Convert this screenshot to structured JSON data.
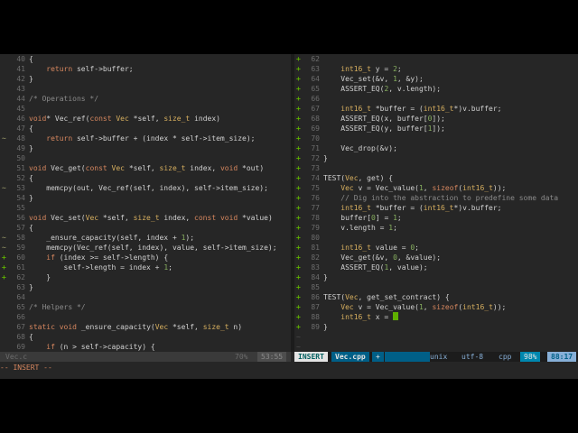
{
  "left_pane": {
    "lines": [
      {
        "n": "40",
        "s": "",
        "t": "{"
      },
      {
        "n": "41",
        "s": "",
        "t": "    return self->buffer;"
      },
      {
        "n": "42",
        "s": "",
        "t": "}"
      },
      {
        "n": "43",
        "s": "",
        "t": ""
      },
      {
        "n": "44",
        "s": "",
        "t": "/* Operations */"
      },
      {
        "n": "45",
        "s": "",
        "t": ""
      },
      {
        "n": "46",
        "s": "",
        "t": "void* Vec_ref(const Vec *self, size_t index)"
      },
      {
        "n": "47",
        "s": "",
        "t": "{"
      },
      {
        "n": "48",
        "s": "~",
        "t": "    return self->buffer + (index * self->item_size);"
      },
      {
        "n": "49",
        "s": "",
        "t": "}"
      },
      {
        "n": "50",
        "s": "",
        "t": ""
      },
      {
        "n": "51",
        "s": "",
        "t": "void Vec_get(const Vec *self, size_t index, void *out)"
      },
      {
        "n": "52",
        "s": "",
        "t": "{"
      },
      {
        "n": "53",
        "s": "~",
        "t": "    memcpy(out, Vec_ref(self, index), self->item_size);"
      },
      {
        "n": "54",
        "s": "",
        "t": "}"
      },
      {
        "n": "55",
        "s": "",
        "t": ""
      },
      {
        "n": "56",
        "s": "",
        "t": "void Vec_set(Vec *self, size_t index, const void *value)"
      },
      {
        "n": "57",
        "s": "",
        "t": "{"
      },
      {
        "n": "58",
        "s": "~",
        "t": "    _ensure_capacity(self, index + 1);"
      },
      {
        "n": "59",
        "s": "~",
        "t": "    memcpy(Vec_ref(self, index), value, self->item_size);"
      },
      {
        "n": "60",
        "s": "+",
        "t": "    if (index >= self->length) {"
      },
      {
        "n": "61",
        "s": "+",
        "t": "        self->length = index + 1;"
      },
      {
        "n": "62",
        "s": "+",
        "t": "    }"
      },
      {
        "n": "63",
        "s": "",
        "t": "}"
      },
      {
        "n": "64",
        "s": "",
        "t": ""
      },
      {
        "n": "65",
        "s": "",
        "t": "/* Helpers */"
      },
      {
        "n": "66",
        "s": "",
        "t": ""
      },
      {
        "n": "67",
        "s": "",
        "t": "static void _ensure_capacity(Vec *self, size_t n)"
      },
      {
        "n": "68",
        "s": "",
        "t": "{"
      },
      {
        "n": "69",
        "s": "",
        "t": "    if (n > self->capacity) {"
      }
    ],
    "status": {
      "filename": "Vec.c",
      "percent": "70%",
      "position": "53:55"
    }
  },
  "right_pane": {
    "lines": [
      {
        "n": "62",
        "s": "+",
        "t": ""
      },
      {
        "n": "63",
        "s": "+",
        "t": "    int16_t y = 2;"
      },
      {
        "n": "64",
        "s": "+",
        "t": "    Vec_set(&v, 1, &y);"
      },
      {
        "n": "65",
        "s": "+",
        "t": "    ASSERT_EQ(2, v.length);"
      },
      {
        "n": "66",
        "s": "+",
        "t": ""
      },
      {
        "n": "67",
        "s": "+",
        "t": "    int16_t *buffer = (int16_t*)v.buffer;"
      },
      {
        "n": "68",
        "s": "+",
        "t": "    ASSERT_EQ(x, buffer[0]);"
      },
      {
        "n": "69",
        "s": "+",
        "t": "    ASSERT_EQ(y, buffer[1]);"
      },
      {
        "n": "70",
        "s": "+",
        "t": ""
      },
      {
        "n": "71",
        "s": "+",
        "t": "    Vec_drop(&v);"
      },
      {
        "n": "72",
        "s": "+",
        "t": "}"
      },
      {
        "n": "73",
        "s": "+",
        "t": ""
      },
      {
        "n": "74",
        "s": "+",
        "t": "TEST(Vec, get) {"
      },
      {
        "n": "75",
        "s": "+",
        "t": "    Vec v = Vec_value(1, sizeof(int16_t));"
      },
      {
        "n": "76",
        "s": "+",
        "t": "    // Dig into the abstraction to predefine some data"
      },
      {
        "n": "77",
        "s": "+",
        "t": "    int16_t *buffer = (int16_t*)v.buffer;"
      },
      {
        "n": "78",
        "s": "+",
        "t": "    buffer[0] = 1;"
      },
      {
        "n": "79",
        "s": "+",
        "t": "    v.length = 1;"
      },
      {
        "n": "80",
        "s": "+",
        "t": ""
      },
      {
        "n": "81",
        "s": "+",
        "t": "    int16_t value = 0;"
      },
      {
        "n": "82",
        "s": "+",
        "t": "    Vec_get(&v, 0, &value);"
      },
      {
        "n": "83",
        "s": "+",
        "t": "    ASSERT_EQ(1, value);"
      },
      {
        "n": "84",
        "s": "+",
        "t": "}"
      },
      {
        "n": "85",
        "s": "+",
        "t": ""
      },
      {
        "n": "86",
        "s": "+",
        "t": "TEST(Vec, get_set_contract) {"
      },
      {
        "n": "87",
        "s": "+",
        "t": "    Vec v = Vec_value(1, sizeof(int16_t));"
      },
      {
        "n": "88",
        "s": "+",
        "t": "    int16_t x = "
      },
      {
        "n": "89",
        "s": "+",
        "t": "}"
      }
    ],
    "tildes": 2,
    "status": {
      "mode": "INSERT",
      "filename": "Vec.cpp",
      "modified": "+",
      "fileformat": "unix",
      "encoding": "utf-8",
      "filetype": "cpp",
      "percent": "98%",
      "position": "88:17"
    }
  },
  "cmdline": "-- INSERT --",
  "colors": {
    "accent": "#5faf00",
    "addSign": "#5faf00",
    "modSign": "#87875f",
    "insertBg": "#005f87"
  }
}
